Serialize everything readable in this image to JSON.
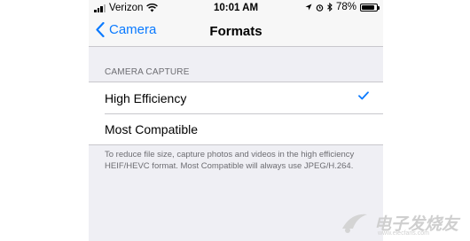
{
  "status_bar": {
    "carrier": "Verizon",
    "time": "10:01 AM",
    "battery": "78%",
    "battery_level": 0.78
  },
  "nav": {
    "back_label": "Camera",
    "title": "Formats"
  },
  "section": {
    "header": "CAMERA CAPTURE",
    "options": [
      {
        "label": "High Efficiency",
        "selected": true
      },
      {
        "label": "Most Compatible",
        "selected": false
      }
    ],
    "footer": "To reduce file size, capture photos and videos in the high efficiency HEIF/HEVC format. Most Compatible will always use JPEG/H.264."
  },
  "watermark": {
    "text": "电子发烧友",
    "url": "www.elecfans.com"
  },
  "colors": {
    "accent": "#0a7aff",
    "background": "#efeff4"
  }
}
